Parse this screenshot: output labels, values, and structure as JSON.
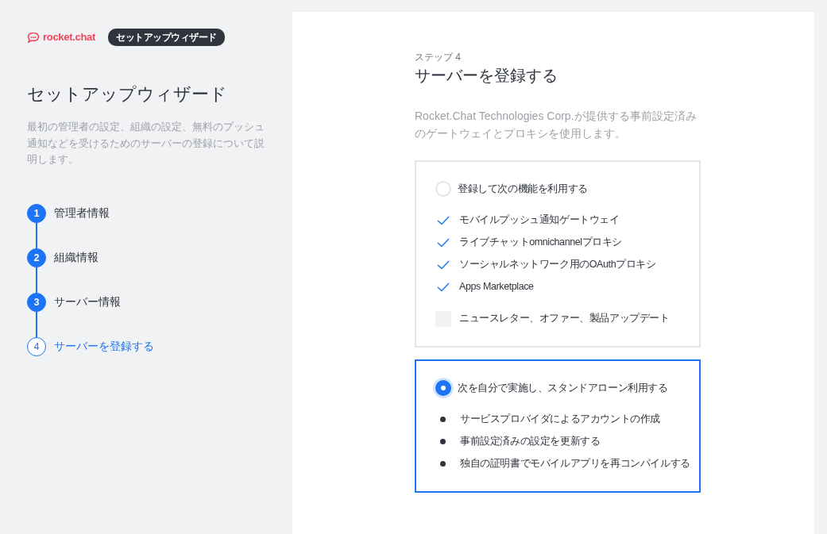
{
  "sidebar": {
    "logo_text": "rocket.chat",
    "badge": "セットアップウィザード",
    "title": "セットアップウィザード",
    "description": "最初の管理者の設定、組織の設定、無料のプッシュ通知などを受けるためのサーバーの登録について説明します。",
    "steps": [
      {
        "number": "1",
        "label": "管理者情報",
        "selected": false,
        "done": true
      },
      {
        "number": "2",
        "label": "組織情報",
        "selected": false,
        "done": true
      },
      {
        "number": "3",
        "label": "サーバー情報",
        "selected": false,
        "done": true
      },
      {
        "number": "4",
        "label": "サーバーを登録する",
        "selected": true,
        "done": false
      }
    ]
  },
  "main": {
    "step_label": "ステップ 4",
    "title": "サーバーを登録する",
    "description": "Rocket.Chat Technologies Corp.が提供する事前設定済みのゲートウェイとプロキシを使用します。",
    "options": [
      {
        "label": "登録して次の機能を利用する",
        "selected": false,
        "items": [
          {
            "kind": "check",
            "label": "モバイルプッシュ通知ゲートウェイ"
          },
          {
            "kind": "check",
            "label": "ライブチャットomnichannelプロキシ"
          },
          {
            "kind": "check",
            "label": "ソーシャルネットワーク用のOAuthプロキシ"
          },
          {
            "kind": "check",
            "label": "Apps Marketplace"
          },
          {
            "kind": "checkbox",
            "label": "ニュースレター、オファー、製品アップデート",
            "checked": false
          }
        ]
      },
      {
        "label": "次を自分で実施し、スタンドアローン利用する",
        "selected": true,
        "items": [
          {
            "kind": "bullet",
            "label": "サービスプロバイダによるアカウントの作成"
          },
          {
            "kind": "bullet",
            "label": "事前設定済みの設定を更新する"
          },
          {
            "kind": "bullet",
            "label": "独自の証明書でモバイルアプリを再コンパイルする"
          }
        ]
      }
    ]
  }
}
